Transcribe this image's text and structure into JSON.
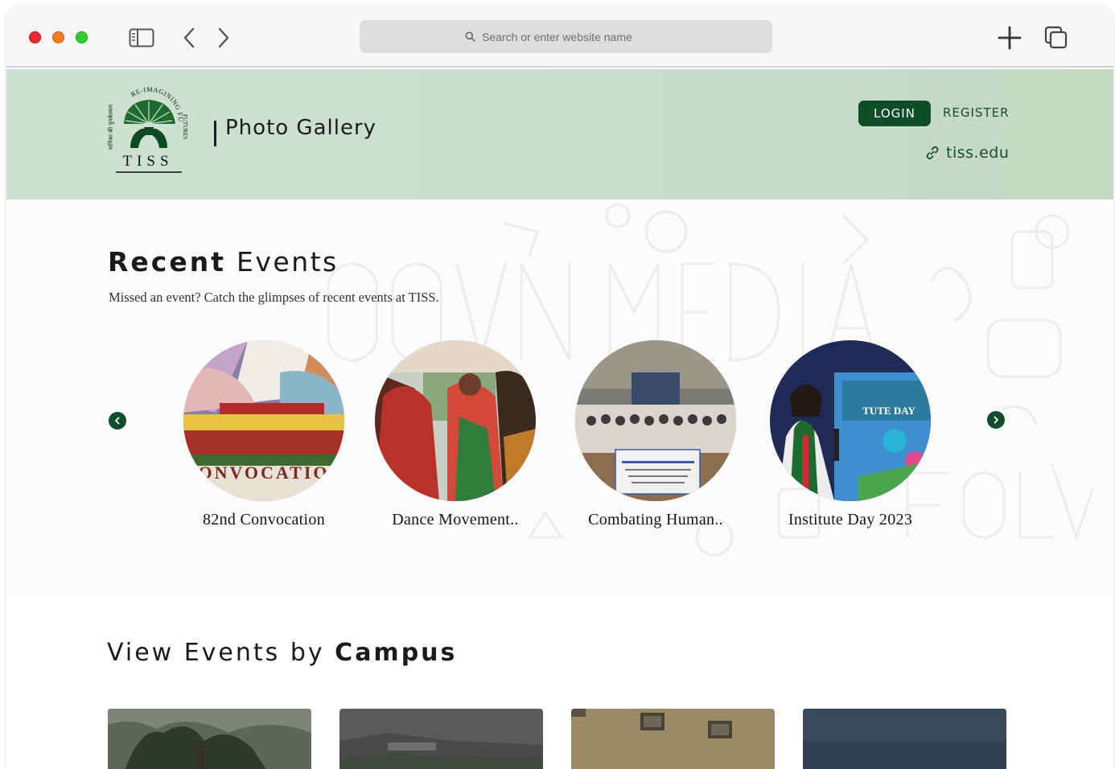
{
  "browser": {
    "search_placeholder": "Search or enter website name"
  },
  "header": {
    "logo_text": "TISS",
    "logo_tagline": "RE-IMAGINING FUTURES",
    "page_title": "Photo Gallery",
    "login_label": "LOGIN",
    "register_label": "REGISTER",
    "site_link": "tiss.edu"
  },
  "recent": {
    "title_bold": "Recent",
    "title_rest": " Events",
    "subtitle": "Missed an event? Catch the glimpses of recent events at TISS.",
    "events": [
      {
        "label": "82nd Convocation",
        "photo_text": "ONVOCATIO"
      },
      {
        "label": "Dance Movement.."
      },
      {
        "label": "Combating Human.."
      },
      {
        "label": "Institute Day 2023",
        "photo_text": "TUTE DAY"
      }
    ]
  },
  "campus": {
    "title_rest": "View Events by ",
    "title_bold": "Campus"
  },
  "colors": {
    "brand_green": "#0f4d2b",
    "header_bg": "#c8dec9",
    "nav_arrow": "#114f2c"
  }
}
